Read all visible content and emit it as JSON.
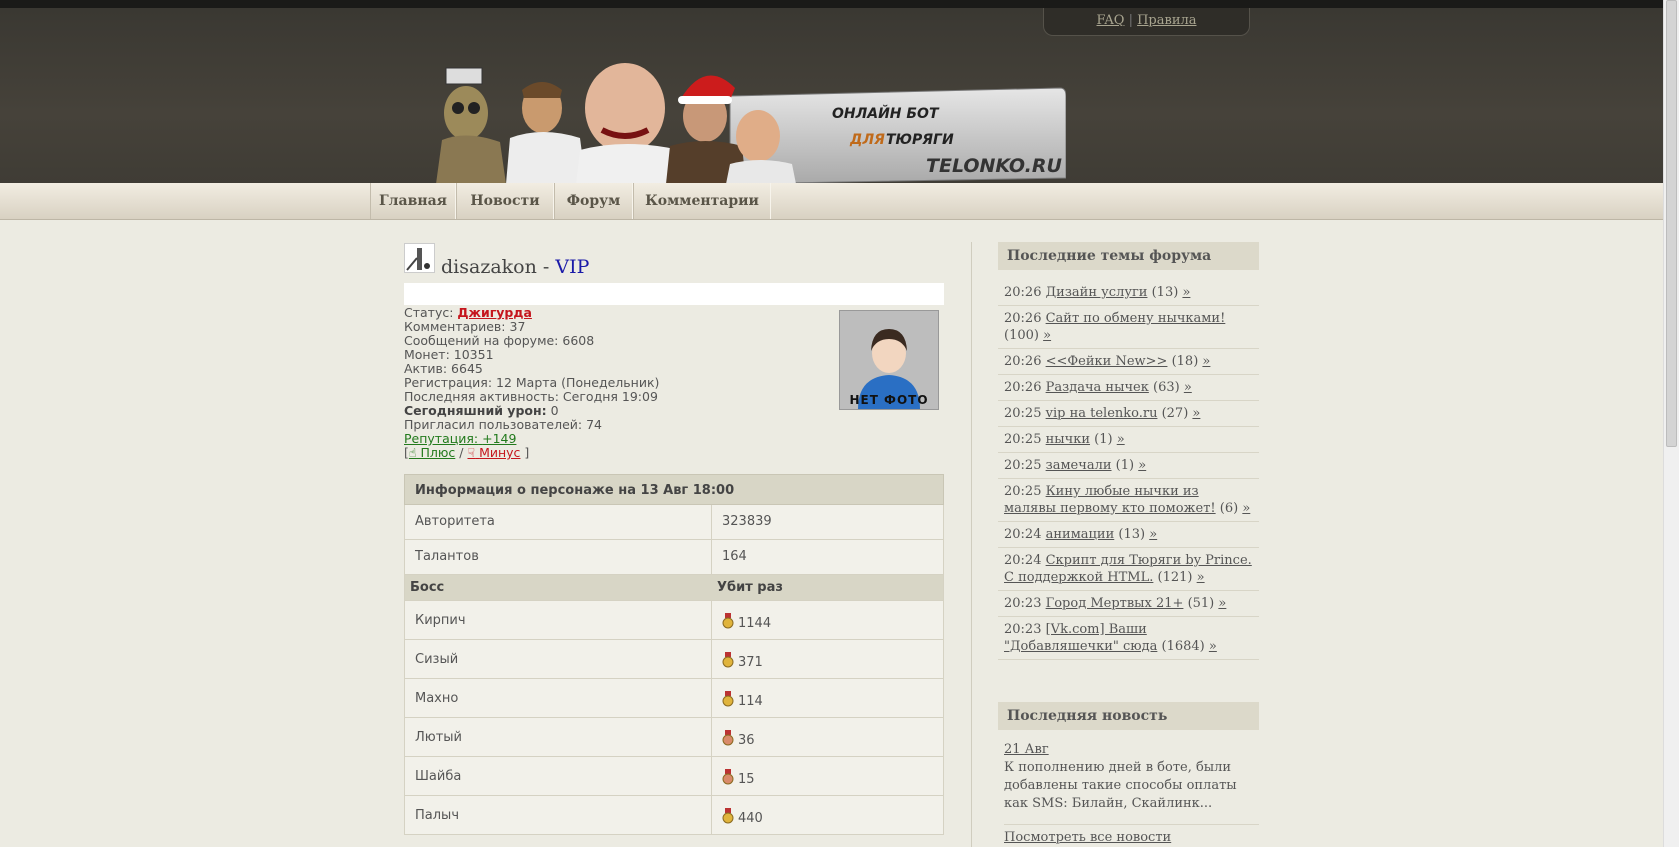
{
  "header": {
    "faq": "FAQ",
    "rules": "Правила",
    "logo_line1": "ОНЛАЙН БОТ",
    "logo_line2a": "ДЛЯ",
    "logo_line2b": "ТЮРЯГИ",
    "logo_site": "TELONKO.RU"
  },
  "nav": [
    "Главная",
    "Новости",
    "Форум",
    "Комментарии"
  ],
  "profile": {
    "username": "disazakon",
    "dash": "-",
    "rank": "VIP",
    "status_label": "Статус:",
    "status_value": "Джигурда",
    "comments": "Комментариев: 37",
    "forum_posts": "Сообщений на форуме: 6608",
    "coins": "Монет: 10351",
    "active": "Актив: 6645",
    "registered": "Регистрация: 12 Марта (Понедельник)",
    "last_active": "Последняя активность: Сегодня 19:09",
    "damage_label": "Сегодняшний урон:",
    "damage_value": "0",
    "invited": "Пригласил пользователей: 74",
    "reputation_label": "Репутация:",
    "reputation_value": "+149",
    "plus": "Плюс",
    "minus": "Минус",
    "photo_label": "НЕТ ФОТО"
  },
  "character": {
    "title": "Информация о персонаже на 13 Авг 18:00",
    "stats": [
      {
        "label": "Авторитета",
        "value": "323839"
      },
      {
        "label": "Талантов",
        "value": "164"
      }
    ],
    "boss_header": "Босс",
    "kills_header": "Убит раз",
    "bosses": [
      {
        "name": "Кирпич",
        "kills": "1144",
        "medal": "gold"
      },
      {
        "name": "Сизый",
        "kills": "371",
        "medal": "gold"
      },
      {
        "name": "Махно",
        "kills": "114",
        "medal": "gold"
      },
      {
        "name": "Лютый",
        "kills": "36",
        "medal": "bronze"
      },
      {
        "name": "Шайба",
        "kills": "15",
        "medal": "bronze"
      },
      {
        "name": "Палыч",
        "kills": "440",
        "medal": "gold"
      }
    ]
  },
  "sidebar": {
    "forum_title": "Последние темы форума",
    "topics": [
      {
        "time": "20:26",
        "title": "Дизайн услуги",
        "count": "(13)"
      },
      {
        "time": "20:26",
        "title": "Сайт по обмену нычками!",
        "count": "(100)"
      },
      {
        "time": "20:26",
        "title": "<<Фейки New>>",
        "count": "(18)"
      },
      {
        "time": "20:26",
        "title": "Раздача нычек",
        "count": "(63)"
      },
      {
        "time": "20:25",
        "title": "vip на telenko.ru",
        "count": "(27)"
      },
      {
        "time": "20:25",
        "title": "нычки",
        "count": "(1)"
      },
      {
        "time": "20:25",
        "title": "замечали",
        "count": "(1)"
      },
      {
        "time": "20:25",
        "title": "Кину любые нычки из малявы первому кто поможет!",
        "count": "(6)"
      },
      {
        "time": "20:24",
        "title": "анимации",
        "count": "(13)"
      },
      {
        "time": "20:24",
        "title": "Скрипт для Тюряги by Prince. С поддержкой HTML.",
        "count": "(121)"
      },
      {
        "time": "20:23",
        "title": "Город Мертвых 21+",
        "count": "(51)"
      },
      {
        "time": "20:23",
        "title": "[Vk.com] Ваши \"Добавляшечки\" сюда",
        "count": "(1684)"
      }
    ],
    "more": "»",
    "news_title": "Последняя новость",
    "news_date": "21 Авг",
    "news_text": "К пополнению дней в боте, были добавлены такие способы оплаты как SMS: Билайн, Скайлинк...",
    "all_news": "Посмотреть все новости"
  }
}
